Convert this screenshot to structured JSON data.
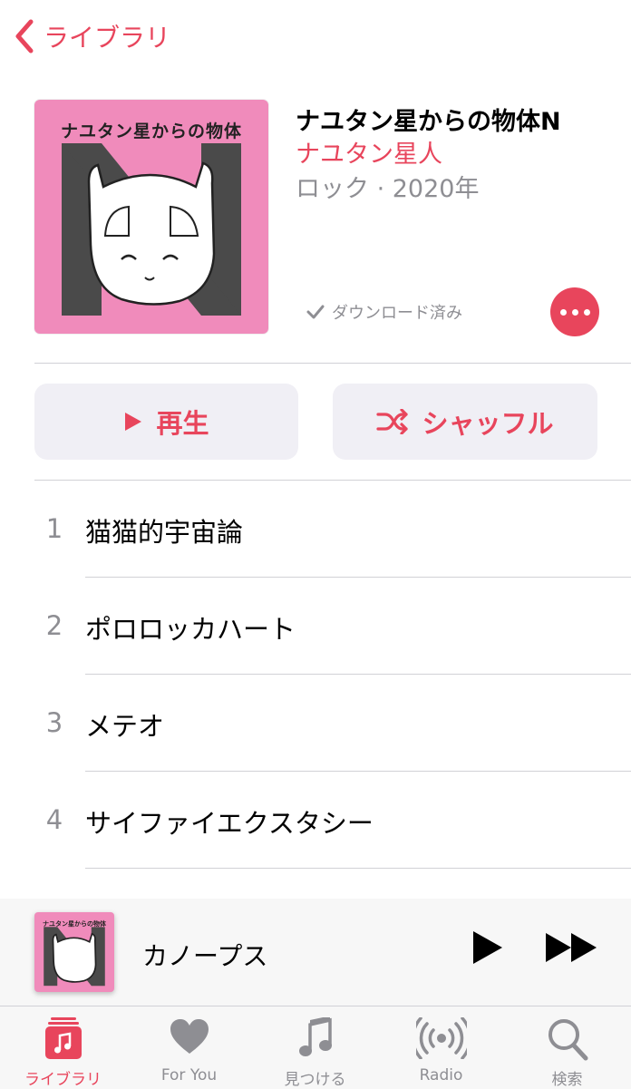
{
  "nav": {
    "back_label": "ライブラリ"
  },
  "album": {
    "art_text": "ナユタン星からの物体",
    "title": "ナユタン星からの物体N",
    "artist": "ナユタン星人",
    "meta": "ロック · 2020年",
    "download_status": "ダウンロード済み"
  },
  "actions": {
    "play_label": "再生",
    "shuffle_label": "シャッフル"
  },
  "tracks": [
    {
      "num": "1",
      "name": "猫猫的宇宙論"
    },
    {
      "num": "2",
      "name": "ポロロッカハート"
    },
    {
      "num": "3",
      "name": "メテオ"
    },
    {
      "num": "4",
      "name": "サイファイエクスタシー"
    }
  ],
  "now_playing": {
    "title": "カノープス",
    "art_text": "ナユタン星からの物体"
  },
  "tabbar": {
    "items": [
      {
        "label": "ライブラリ",
        "icon": "library-icon",
        "active": true
      },
      {
        "label": "For You",
        "icon": "heart-icon",
        "active": false
      },
      {
        "label": "見つける",
        "icon": "music-note-icon",
        "active": false
      },
      {
        "label": "Radio",
        "icon": "radio-icon",
        "active": false
      },
      {
        "label": "検索",
        "icon": "search-icon",
        "active": false
      }
    ]
  },
  "colors": {
    "accent": "#e8455c",
    "art_pink": "#f08bbb",
    "secondary_text": "#8e8e93"
  }
}
